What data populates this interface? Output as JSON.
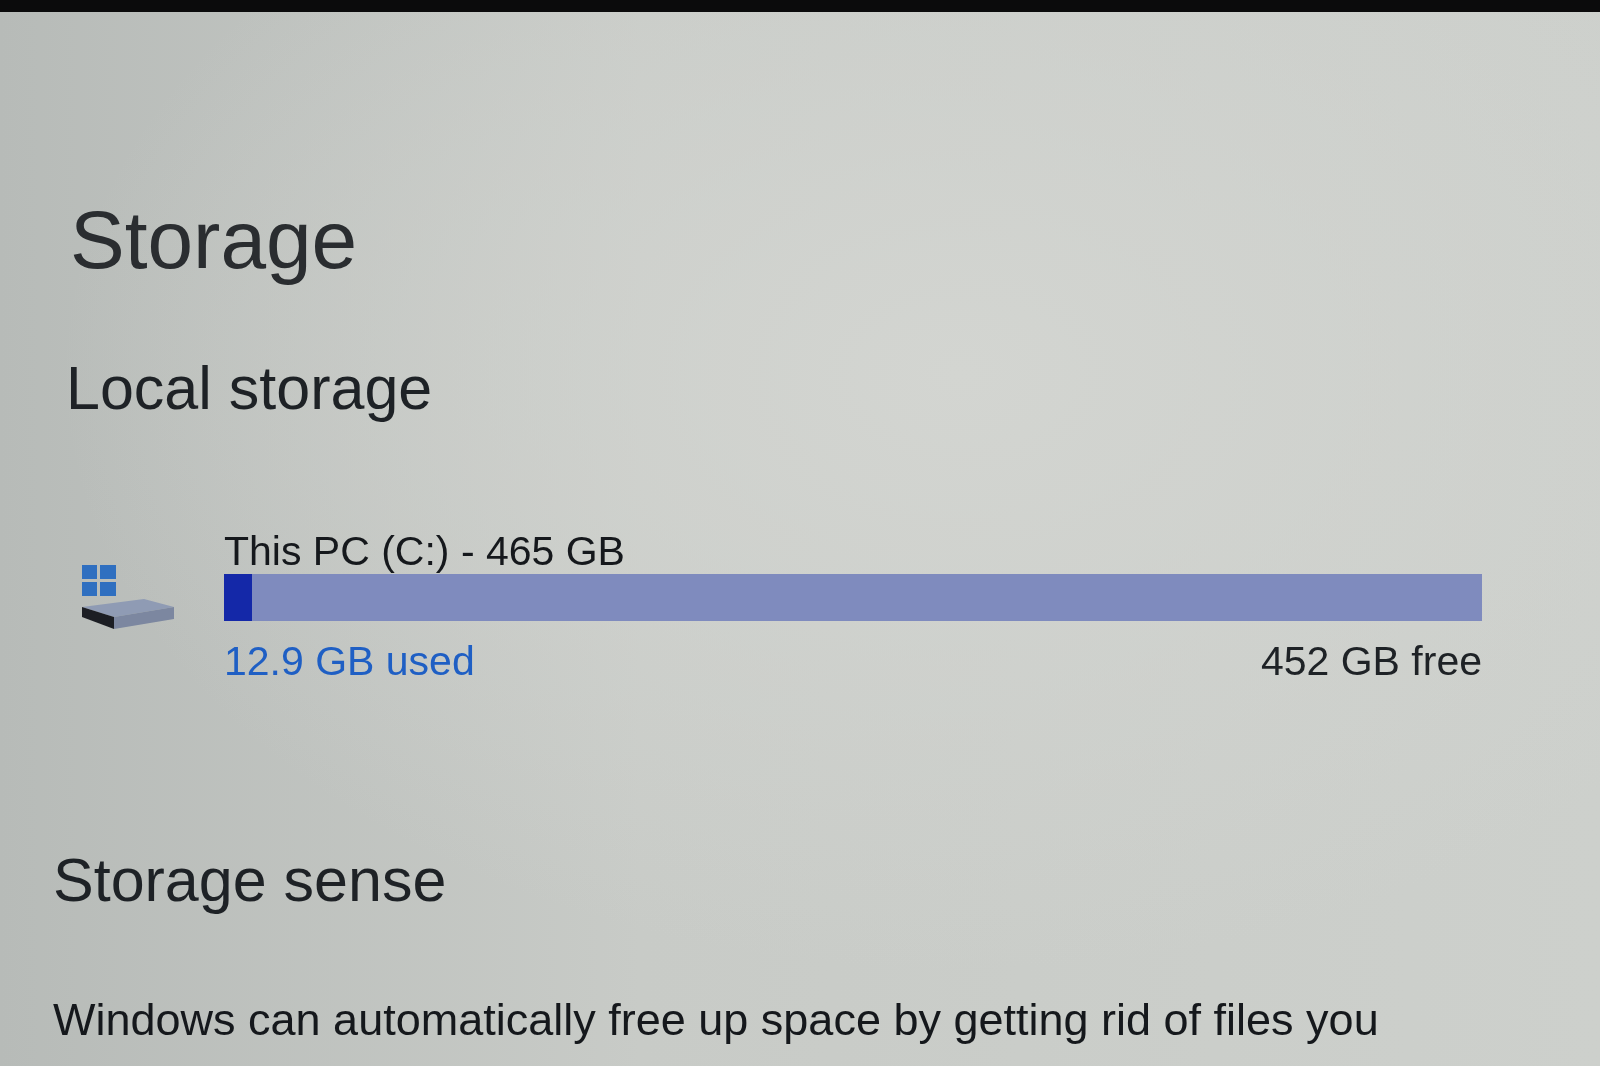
{
  "page": {
    "title": "Storage"
  },
  "local_storage": {
    "heading": "Local storage",
    "drives": [
      {
        "name": "This PC (C:) - 465 GB",
        "level": 0.022,
        "used": "12.9 GB used",
        "free": "452 GB free"
      }
    ]
  },
  "storage_sense": {
    "heading": "Storage sense",
    "description": "Windows can automatically free up space by getting rid of files you"
  }
}
